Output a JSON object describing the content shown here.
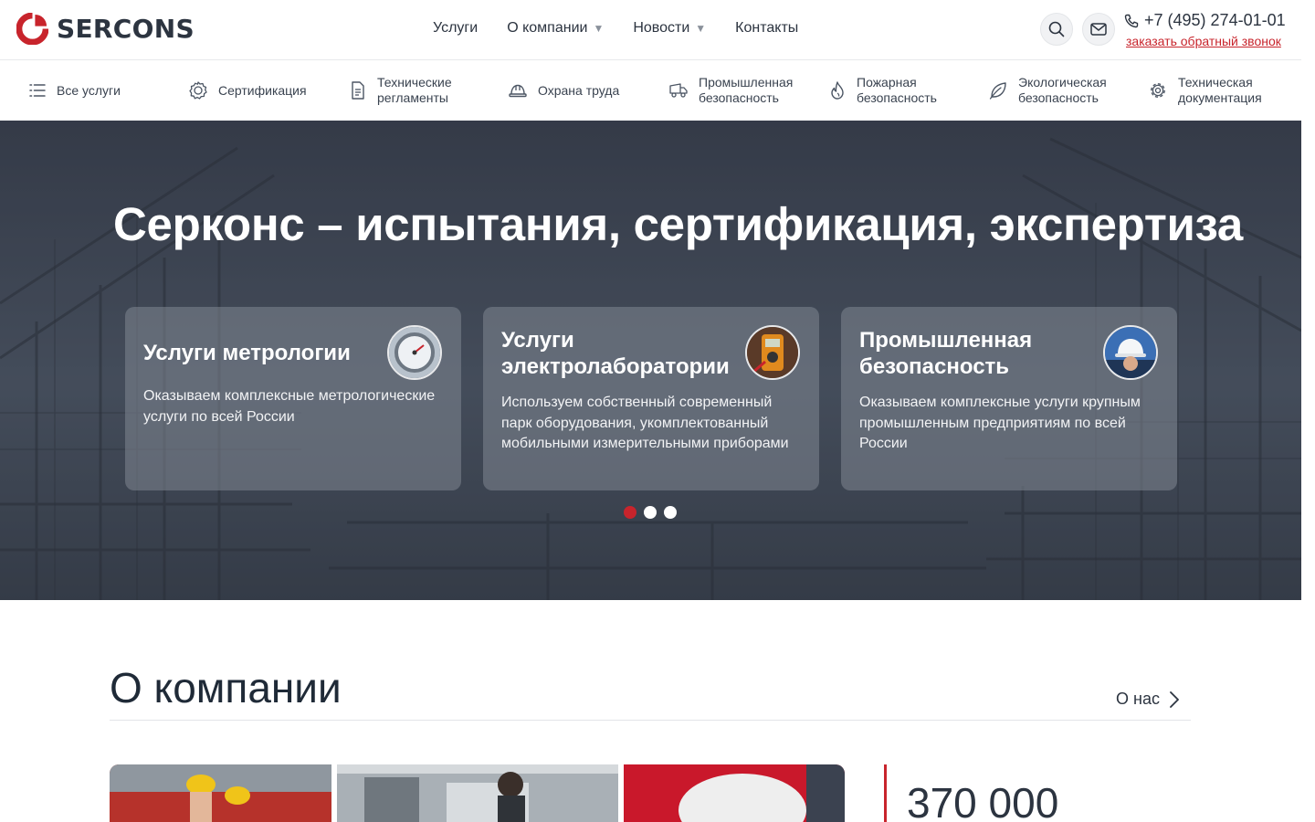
{
  "brand": {
    "name": "SERCONS",
    "accent": "#c8242c"
  },
  "topnav": [
    {
      "label": "Услуги",
      "dropdown": false
    },
    {
      "label": "О компании",
      "dropdown": true
    },
    {
      "label": "Новости",
      "dropdown": true
    },
    {
      "label": "Контакты",
      "dropdown": false
    }
  ],
  "contact": {
    "phone": "+7 (495) 274-01-01",
    "callback": "заказать обратный звонок"
  },
  "services": [
    {
      "label": "Все услуги",
      "icon": "list-icon"
    },
    {
      "label": "Сертификация",
      "icon": "certificate-icon"
    },
    {
      "label": "Технические\nрегламенты",
      "icon": "document-icon"
    },
    {
      "label": "Охрана труда",
      "icon": "hardhat-icon"
    },
    {
      "label": "Промышленная\nбезопасность",
      "icon": "truck-icon"
    },
    {
      "label": "Пожарная\nбезопасность",
      "icon": "fire-icon"
    },
    {
      "label": "Экологическая\nбезопасность",
      "icon": "leaf-icon"
    },
    {
      "label": "Техническая\nдокументация",
      "icon": "gear-icon"
    }
  ],
  "hero": {
    "title": "Серконс – испытания, сертификация, экспертиза",
    "cards": [
      {
        "title": "Услуги метрологии",
        "text": "Оказываем комплексные метрологические услуги по всей России",
        "image": "pressure-gauge"
      },
      {
        "title": "Услуги электролаборатории",
        "text": "Используем собственный современный парк оборудования, укомплектованный мобильными измерительными приборами",
        "image": "multimeter"
      },
      {
        "title": "Промышленная безопасность",
        "text": "Оказываем комплексные услуги крупным промышленным предприятиям по всей России",
        "image": "worker-helmet"
      }
    ],
    "slides": 3,
    "active_slide": 1
  },
  "about": {
    "title": "О компании",
    "link": "О нас",
    "stat": "370 000"
  }
}
